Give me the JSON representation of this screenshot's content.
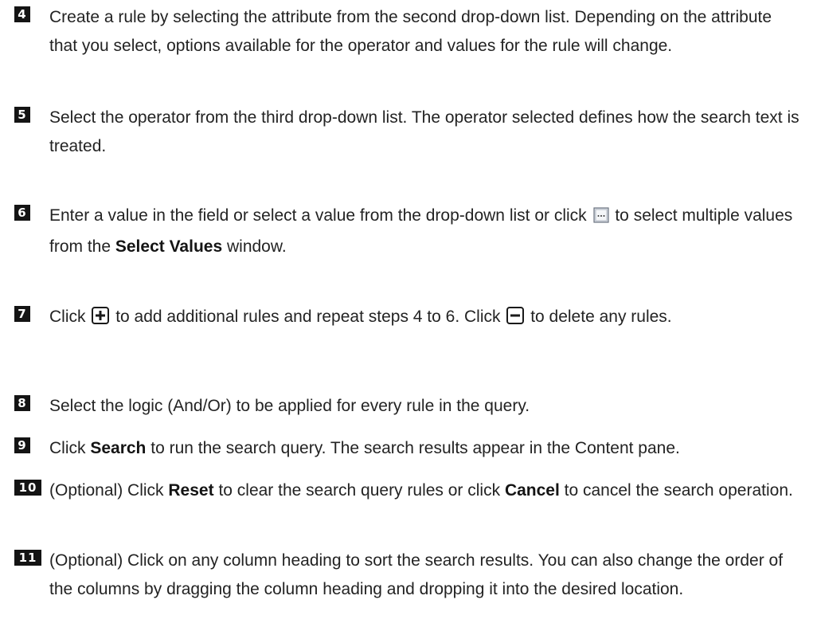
{
  "steps": [
    {
      "number": "4",
      "text": "Create a rule by selecting the attribute from the second drop-down list. Depending on the attribute that you select, options available for the operator and values for the rule will change."
    },
    {
      "number": "5",
      "text": "Select the operator from the third drop-down list. The operator selected defines how the search text is treated."
    },
    {
      "number": "6",
      "text_a": "Enter a value in the field or select a value from the drop-down list or click",
      "text_b": "to select multiple values from the",
      "bold": "Select Values",
      "text_c": "window.",
      "icon": "browse-ellipsis-icon"
    },
    {
      "number": "7",
      "text_a": "Click",
      "icon_a": "plus-icon",
      "text_b": "to add additional rules and repeat steps 4 to 6. Click",
      "icon_b": "minus-icon",
      "text_c": "to delete any rules."
    },
    {
      "number": "8",
      "text": "Select the logic (And/Or) to be applied for every rule in the query."
    },
    {
      "number": "9",
      "text_a": "Click",
      "bold": "Search",
      "text_b": "to run the search query. The search results appear in the Content pane."
    },
    {
      "number": "10",
      "text_a": "(Optional) Click",
      "bold_a": "Reset",
      "text_b": "to clear the search query rules or click",
      "bold_b": "Cancel",
      "text_c": "to cancel the search operation."
    },
    {
      "number": "11",
      "text": "(Optional) Click on any column heading to sort the search results. You can also change the order of the columns by dragging the column heading and dropping it into the desired location."
    }
  ]
}
